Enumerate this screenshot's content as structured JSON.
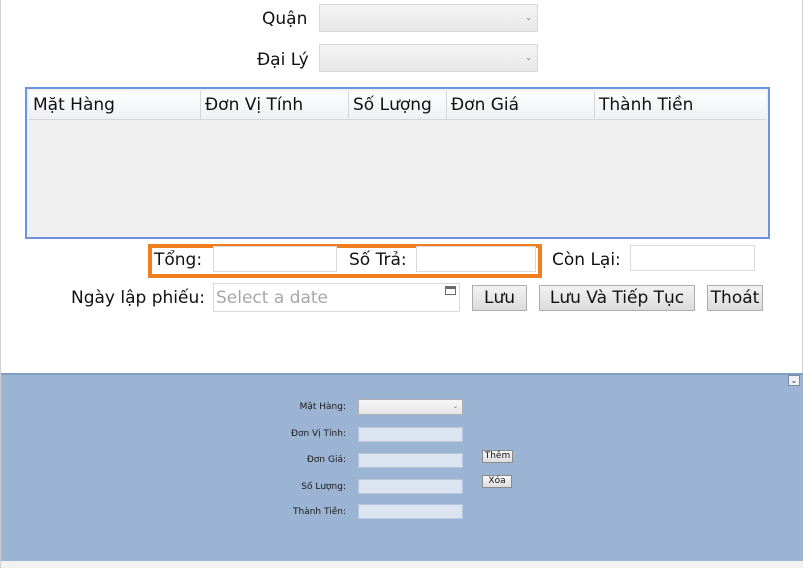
{
  "form": {
    "quan_label": "Quận",
    "daily_label": "Đại Lý",
    "tong_label": "Tổng:",
    "sotra_label": "Số Trả:",
    "conlai_label": "Còn Lại:",
    "ngaylap_label": "Ngày lập phiếu:",
    "date_placeholder": "Select a date"
  },
  "grid": {
    "columns": [
      "Mặt Hàng",
      "Đơn Vị Tính",
      "Số Lượng",
      "Đơn Giá",
      "Thành Tiền"
    ]
  },
  "buttons": {
    "luu": "Lưu",
    "luu_tiep_tuc": "Lưu Và Tiếp Tục",
    "thoat": "Thoát"
  },
  "detail": {
    "mathang_label": "Mặt Hàng:",
    "donvitinh_label": "Đơn Vị Tính:",
    "dongia_label": "Đơn Giá:",
    "soluong_label": "Số Lượng:",
    "thanhtien_label": "Thành Tiền:",
    "them_button": "Thêm",
    "xoa_button": "Xóa"
  },
  "colors": {
    "grid_border": "#6d93e6",
    "highlight_border": "#f07d1e",
    "bottom_panel": "#9bb4d3"
  }
}
